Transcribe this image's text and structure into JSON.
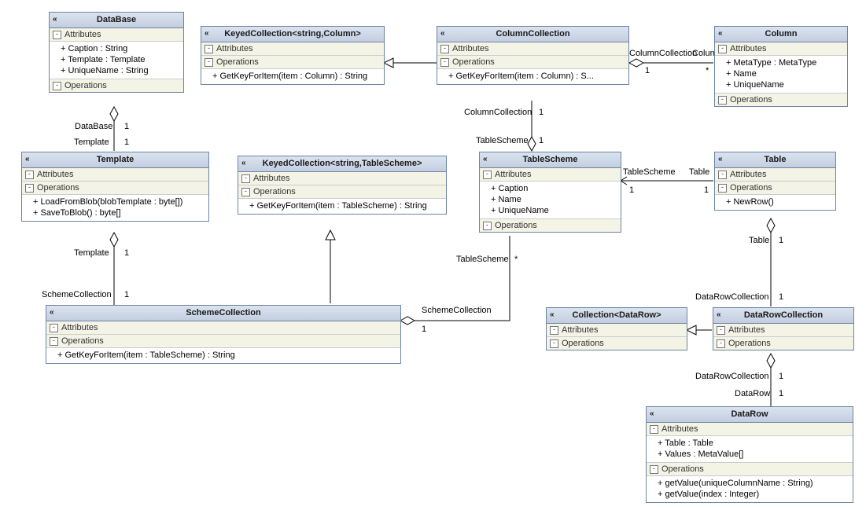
{
  "classes": {
    "database": {
      "title": "DataBase",
      "sections": {
        "attrs_h": "Attributes",
        "ops_h": "Operations",
        "a1": "+ Caption : String",
        "a2": "+ Template : Template",
        "a3": "+ UniqueName : String"
      }
    },
    "keyed_col": {
      "title": "KeyedCollection<string,Column>",
      "sections": {
        "attrs_h": "Attributes",
        "ops_h": "Operations",
        "o1": "+ GetKeyForItem(item : Column) : String"
      }
    },
    "column_collection": {
      "title": "ColumnCollection",
      "sections": {
        "attrs_h": "Attributes",
        "ops_h": "Operations",
        "o1": "+ GetKeyForItem(item : Column) : S..."
      }
    },
    "column": {
      "title": "Column",
      "sections": {
        "attrs_h": "Attributes",
        "ops_h": "Operations",
        "a1": "+ MetaType : MetaType",
        "a2": "+ Name",
        "a3": "+ UniqueName"
      }
    },
    "template": {
      "title": "Template",
      "sections": {
        "attrs_h": "Attributes",
        "ops_h": "Operations",
        "o1": "+ LoadFromBlob(blobTemplate : byte[])",
        "o2": "+ SaveToBlob() : byte[]"
      }
    },
    "keyed_table": {
      "title": "KeyedCollection<string,TableScheme>",
      "sections": {
        "attrs_h": "Attributes",
        "ops_h": "Operations",
        "o1": "+ GetKeyForItem(item : TableScheme) : String"
      }
    },
    "table_scheme": {
      "title": "TableScheme",
      "sections": {
        "attrs_h": "Attributes",
        "ops_h": "Operations",
        "a1": "+ Caption",
        "a2": "+ Name",
        "a3": "+ UniqueName"
      }
    },
    "table": {
      "title": "Table",
      "sections": {
        "attrs_h": "Attributes",
        "ops_h": "Operations",
        "o1": "+ NewRow()"
      }
    },
    "scheme_collection": {
      "title": "SchemeCollection",
      "sections": {
        "attrs_h": "Attributes",
        "ops_h": "Operations",
        "o1": "+ GetKeyForItem(item : TableScheme) : String"
      }
    },
    "collection_datarow": {
      "title": "Collection<DataRow>",
      "sections": {
        "attrs_h": "Attributes",
        "ops_h": "Operations"
      }
    },
    "datarow_collection": {
      "title": "DataRowCollection",
      "sections": {
        "attrs_h": "Attributes",
        "ops_h": "Operations"
      }
    },
    "datarow": {
      "title": "DataRow",
      "sections": {
        "attrs_h": "Attributes",
        "ops_h": "Operations",
        "a1": "+ Table : Table",
        "a2": "+ Values : MetaValue[]",
        "o1": "+ getValue(uniqueColumnName : String)",
        "o2": "+ getValue(index : Integer)"
      }
    }
  },
  "labels": {
    "db_template_1": "DataBase",
    "db_template_1m": "1",
    "db_template_2": "Template",
    "db_template_2m": "1",
    "tpl_scheme_1": "Template",
    "tpl_scheme_1m": "1",
    "tpl_scheme_2": "SchemeCollection",
    "tpl_scheme_2m": "1",
    "colcol_col_1": "ColumnCollection",
    "colcol_col_1m": "1",
    "colcol_col_2": "Column",
    "colcol_col_2m": "*",
    "colcol_ts_1": "ColumnCollection",
    "colcol_ts_1m": "1",
    "colcol_ts_2": "TableScheme",
    "colcol_ts_2m": "1",
    "ts_table_1": "TableScheme",
    "ts_table_1m": "1",
    "ts_table_2": "Table",
    "ts_table_2m": "1",
    "table_drc_1": "Table",
    "table_drc_1m": "1",
    "table_drc_2": "DataRowCollection",
    "table_drc_2m": "1",
    "drc_dr_1": "DataRowCollection",
    "drc_dr_1m": "1",
    "drc_dr_2": "DataRow",
    "drc_dr_2m": "1",
    "sc_ts_1": "SchemeCollection",
    "sc_ts_1m": "1",
    "sc_ts_2": "TableScheme",
    "sc_ts_2m": "*"
  }
}
